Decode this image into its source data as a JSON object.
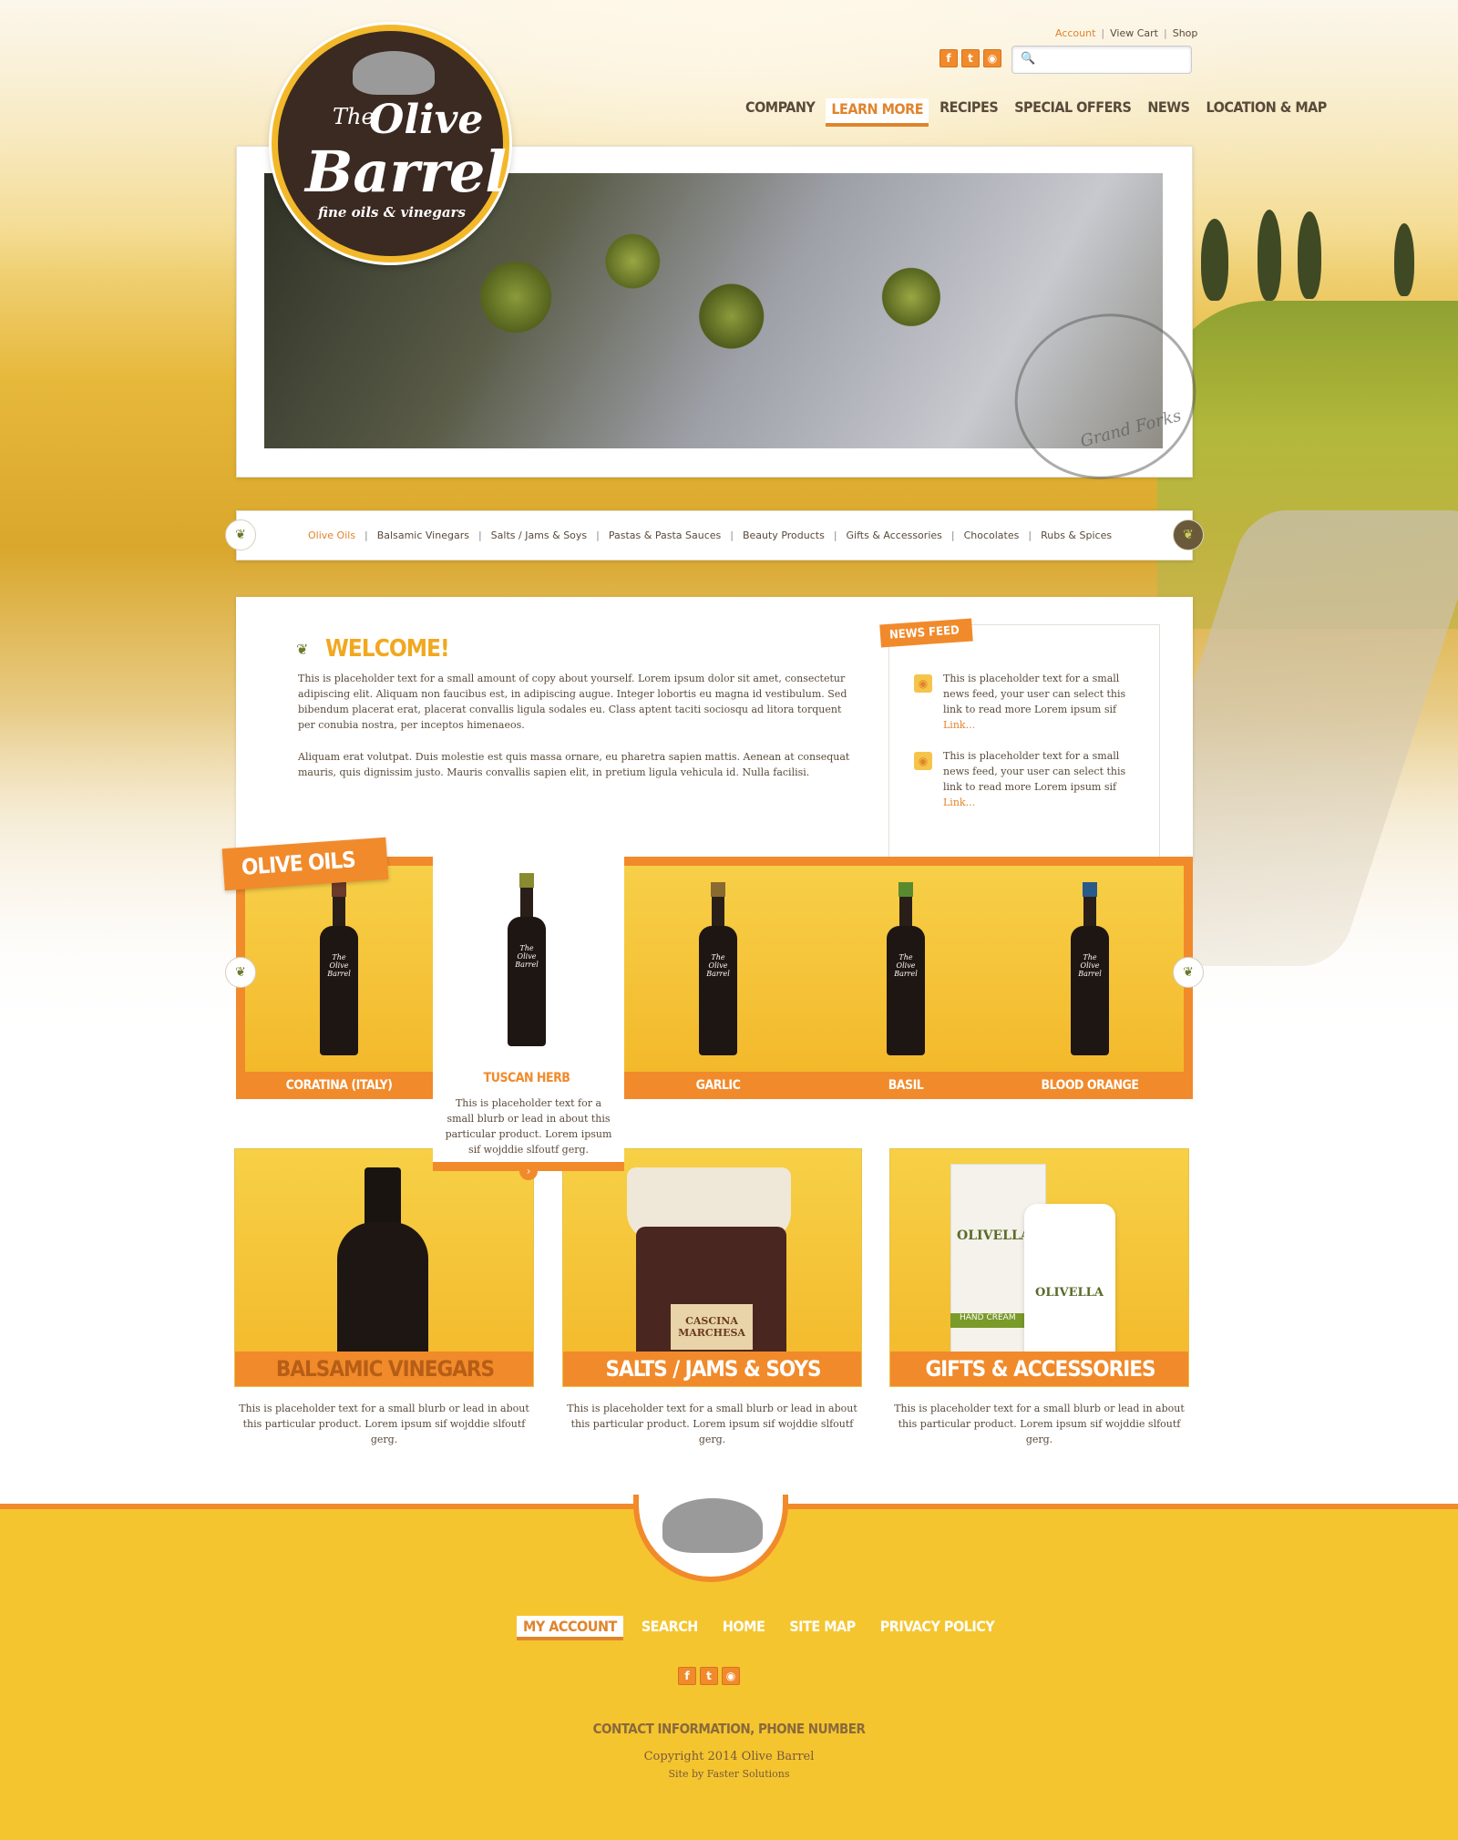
{
  "header": {
    "toplinks": [
      "Account",
      "View Cart",
      "Shop"
    ],
    "social": [
      "f",
      "t",
      "rss"
    ],
    "search_placeholder": "",
    "nav": [
      "COMPANY",
      "LEARN MORE",
      "RECIPES",
      "SPECIAL OFFERS",
      "NEWS",
      "LOCATION & MAP"
    ],
    "nav_active": "LEARN MORE"
  },
  "logo": {
    "the": "The",
    "olive": "Olive",
    "barrel": "Barrel",
    "tagline": "fine oils & vinegars"
  },
  "hero": {
    "stamp_text": "Grand Forks"
  },
  "categories": {
    "items": [
      "Olive Oils",
      "Balsamic Vinegars",
      "Salts / Jams & Soys",
      "Pastas & Pasta Sauces",
      "Beauty Products",
      "Gifts & Accessories",
      "Chocolates",
      "Rubs & Spices"
    ],
    "active": "Olive Oils"
  },
  "welcome": {
    "title": "WELCOME!",
    "p1": "This is placeholder text for a small amount of copy about yourself. Lorem ipsum dolor sit amet, consectetur adipiscing elit. Aliquam non faucibus est, in adipiscing augue. Integer lobortis eu magna id vestibulum. Sed bibendum placerat erat, placerat convallis ligula sodales eu. Class aptent taciti sociosqu ad litora torquent per conubia nostra, per inceptos himenaeos.",
    "p2": "Aliquam erat volutpat. Duis molestie est quis massa ornare, eu pharetra sapien mattis. Aenean at consequat mauris, quis dignissim justo. Mauris convallis sapien elit, in pretium ligula vehicula id. Nulla facilisi."
  },
  "newsfeed": {
    "title": "NEWS FEED",
    "items": [
      {
        "text": "This is placeholder text for a small news feed, your user can select this link to read more Lorem ipsum sif",
        "link": "Link..."
      },
      {
        "text": "This is placeholder text for a small news feed, your user can select this link to read more Lorem ipsum sif",
        "link": "Link..."
      }
    ]
  },
  "oils": {
    "title": "OLIVE OILS",
    "products": [
      "CORATINA (ITALY)",
      "TUSCAN HERB",
      "GARLIC",
      "BASIL",
      "BLOOD ORANGE"
    ],
    "selected_blurb": "This is placeholder text for a small blurb or lead in about this particular product. Lorem ipsum sif wojddie slfoutf gerg.",
    "bottle_label": "The Olive Barrel"
  },
  "cards": [
    {
      "title": "BALSAMIC VINEGARS",
      "text": "This is placeholder text for a small blurb or lead in about this particular product. Lorem ipsum sif wojddie slfoutf gerg."
    },
    {
      "title": "SALTS / JAMS & SOYS",
      "text": "This is placeholder text for a small blurb or lead in about this particular product. Lorem ipsum sif wojddie slfoutf gerg.",
      "jar_label": "CASCINA MARCHESA"
    },
    {
      "title": "GIFTS & ACCESSORIES",
      "text": "This is placeholder text for a small blurb or lead in about this particular product. Lorem ipsum sif wojddie slfoutf gerg.",
      "brand": "OLIVELLA",
      "sub": "HAND CREAM"
    }
  ],
  "footer": {
    "nav": [
      "MY ACCOUNT",
      "SEARCH",
      "HOME",
      "SITE MAP",
      "PRIVACY POLICY"
    ],
    "nav_active": "MY ACCOUNT",
    "contact": "CONTACT INFORMATION, PHONE NUMBER",
    "copyright": "Copyright 2014 Olive Barrel",
    "credit": "Site by Faster Solutions"
  },
  "colors": {
    "accent": "#f18a2b",
    "gold": "#f5c52f",
    "text": "#5a4a3a",
    "dark": "#3b2a22"
  }
}
